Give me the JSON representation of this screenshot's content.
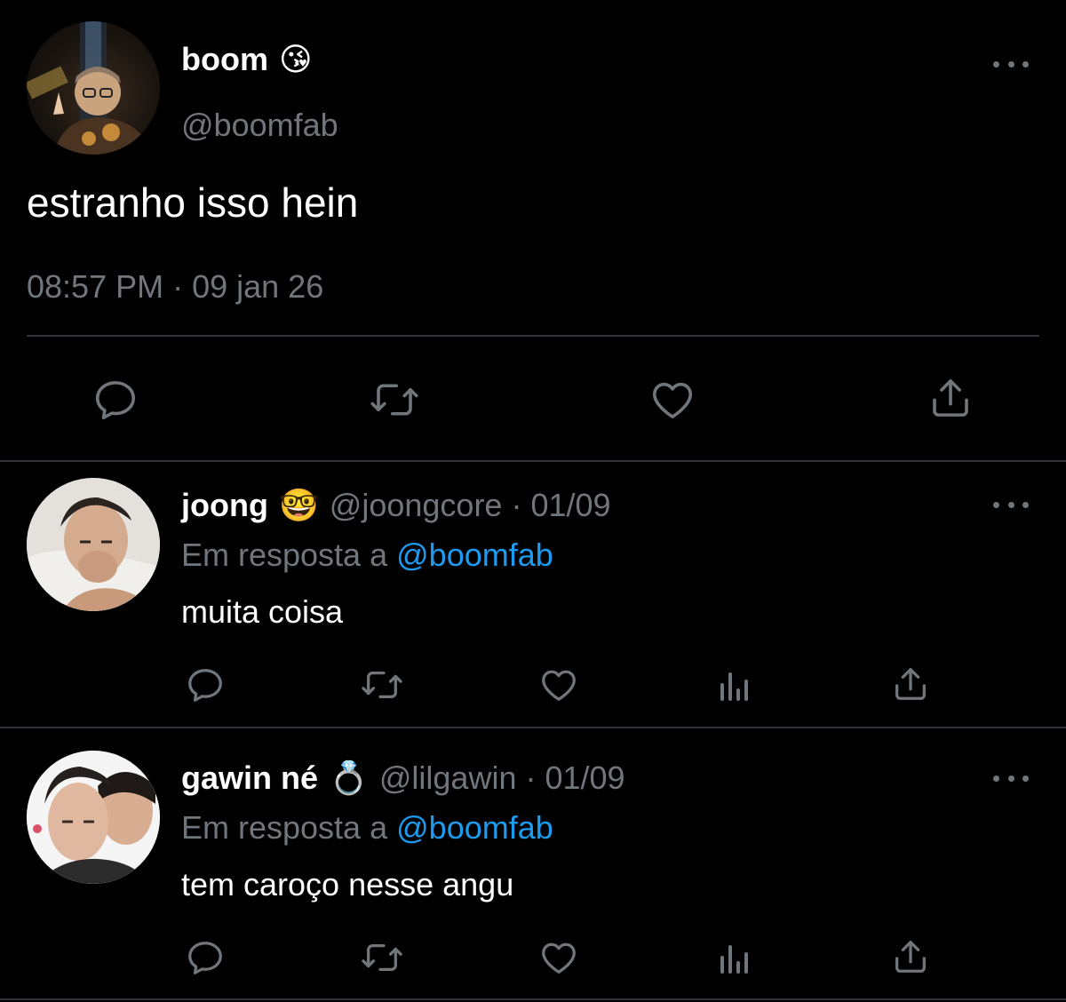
{
  "main_tweet": {
    "display_name": "boom",
    "name_emoji": "😘",
    "handle": "@boomfab",
    "text": "estranho isso hein",
    "timestamp": "08:57 PM · 09 jan 26",
    "actions": [
      "reply-icon",
      "retweet-icon",
      "like-icon",
      "share-icon"
    ]
  },
  "replies": [
    {
      "display_name": "joong",
      "name_emoji": "🤓",
      "handle": "@joongcore",
      "date": "01/09",
      "meta": "@joongcore · 01/09",
      "reply_prefix": "Em resposta a",
      "reply_to": "@boomfab",
      "text": "muita coisa",
      "actions": [
        "reply-icon",
        "retweet-icon",
        "like-icon",
        "views-icon",
        "share-icon"
      ]
    },
    {
      "display_name": "gawin né",
      "name_emoji": "💍",
      "handle": "@lilgawin",
      "date": "01/09",
      "meta": "@lilgawin · 01/09",
      "reply_prefix": "Em resposta a",
      "reply_to": "@boomfab",
      "text": "tem caroço nesse angu",
      "actions": [
        "reply-icon",
        "retweet-icon",
        "like-icon",
        "views-icon",
        "share-icon"
      ]
    }
  ],
  "colors": {
    "background": "#000000",
    "primary_text": "#ffffff",
    "secondary_text": "#71767b",
    "link": "#1d9bf0",
    "divider": "#2f3336"
  }
}
